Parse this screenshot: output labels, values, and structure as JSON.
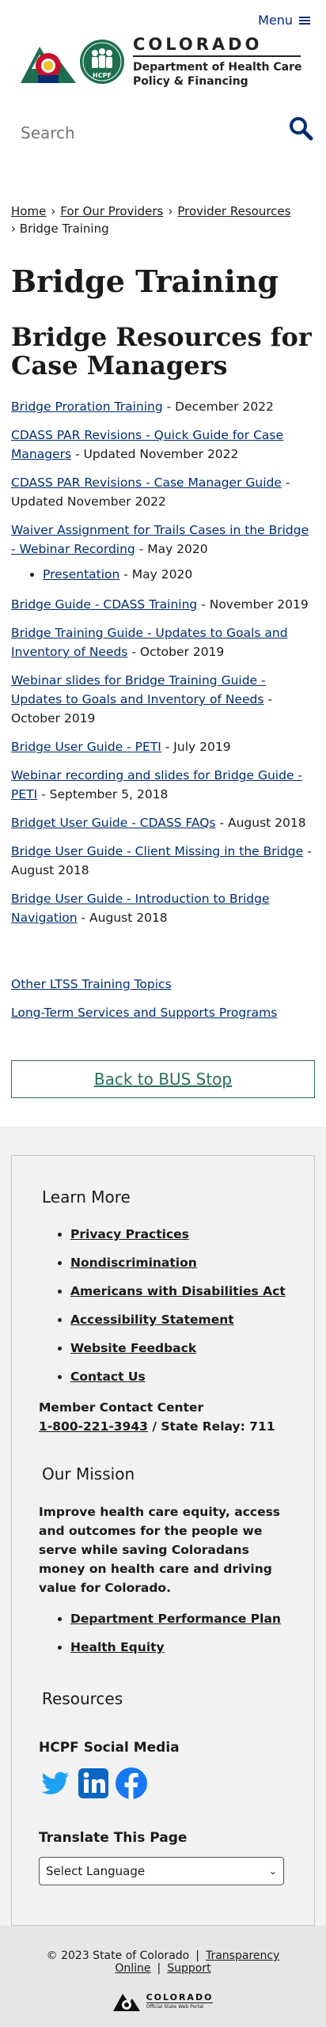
{
  "header": {
    "menu_label": "Menu",
    "brand_name": "COLORADO",
    "dept_line1": "Department of Health Care",
    "dept_line2": "Policy & Financing",
    "badge_text": "HCPF"
  },
  "search": {
    "placeholder": "Search"
  },
  "breadcrumb": {
    "items": [
      "Home",
      "For Our Providers",
      "Provider Resources"
    ],
    "current": "Bridge Training"
  },
  "page_title": "Bridge Training",
  "section_title": "Bridge Resources for Case Managers",
  "resources": [
    {
      "link": "Bridge Proration Training",
      "suffix": " - December 2022"
    },
    {
      "link": "CDASS PAR Revisions - Quick Guide for Case Managers",
      "suffix": " - Updated November 2022"
    },
    {
      "link": "CDASS PAR Revisions - Case Manager Guide",
      "suffix": " - Updated November 2022"
    },
    {
      "link": "Waiver Assignment for Trails Cases in the Bridge - Webinar Recording",
      "suffix": " - May 2020"
    },
    {
      "link": "Presentation",
      "suffix": " - May 2020"
    },
    {
      "link": "Bridge Guide - CDASS Training",
      "suffix": " - November 2019"
    },
    {
      "link": "Bridge Training Guide - Updates to Goals and Inventory of Needs",
      "suffix": " - October 2019"
    },
    {
      "link": "Webinar slides for Bridge Training Guide - Updates to Goals and Inventory of Needs",
      "suffix": " - October 2019"
    },
    {
      "link": "Bridge User Guide - PETI",
      "suffix": " - July 2019"
    },
    {
      "link": "Webinar recording and slides for Bridge Guide - PETI",
      "suffix": " - September 5, 2018"
    },
    {
      "link": "Bridget User Guide - CDASS FAQs",
      "suffix": " - August 2018"
    },
    {
      "link": "Bridge User Guide - Client Missing in the Bridge",
      "suffix": " - August 2018"
    },
    {
      "link": "Bridge User Guide - Introduction to Bridge Navigation",
      "suffix": " - August 2018"
    }
  ],
  "other_links": [
    "Other LTSS Training Topics",
    "Long-Term Services and Supports Programs"
  ],
  "back_button": "Back to BUS Stop",
  "footer": {
    "learn_more": "Learn More",
    "learn_items": [
      "Privacy Practices",
      "Nondiscrimination",
      "Americans with Disabilities Act",
      "Accessibility Statement",
      "Website Feedback",
      "Contact Us"
    ],
    "contact_label": "Member Contact Center",
    "contact_phone": "1-800-221-3943",
    "contact_relay": " / State Relay: 711",
    "mission_head": "Our Mission",
    "mission_text": "Improve health care equity, access and outcomes for the people we serve while saving Coloradans money on health care and driving value for Colorado.",
    "mission_items": [
      "Department Performance Plan",
      "Health Equity"
    ],
    "resources_head": "Resources",
    "social_head": "HCPF Social Media",
    "social_icons": [
      "twitter-icon",
      "linkedin-icon",
      "facebook-icon"
    ],
    "translate_head": "Translate This Page",
    "select_value": "Select Language"
  },
  "bottom": {
    "copyright": "© 2023 State of Colorado",
    "transparency": "Transparency Online",
    "support": "Support",
    "portal_name": "COLORADO",
    "portal_tag": "Official State Web Portal"
  },
  "colors": {
    "brand_blue": "#002d72",
    "button_green": "#2a6f5c",
    "hcpf_green": "#1e6e4f"
  }
}
